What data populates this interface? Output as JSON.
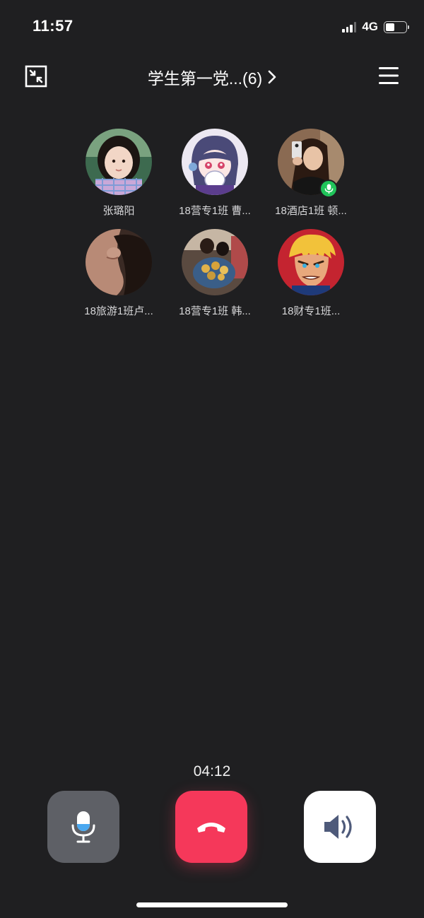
{
  "status_bar": {
    "time": "11:57",
    "network": "4G"
  },
  "nav": {
    "title": "学生第一党...(6)",
    "minimize_icon": "minimize-icon",
    "chevron_icon": "chevron-right-icon",
    "menu_icon": "menu-icon"
  },
  "participants": [
    {
      "name": "张璐阳",
      "avatar": "girl-photo"
    },
    {
      "name": "18营专1班 曹...",
      "avatar": "anime-girl"
    },
    {
      "name": "18酒店1班 顿...",
      "avatar": "selfie-photo",
      "speaking": true
    },
    {
      "name": "18旅游1班卢...",
      "avatar": "profile-photo"
    },
    {
      "name": "18营专1班 韩...",
      "avatar": "bouquet-photo"
    },
    {
      "name": "18财专1班...",
      "avatar": "cartoon-hero"
    }
  ],
  "call": {
    "duration": "04:12",
    "mute_icon": "microphone-icon",
    "hangup_icon": "hang-up-icon",
    "speaker_icon": "speaker-icon"
  },
  "colors": {
    "background": "#1f1f21",
    "hangup": "#f5385a",
    "mute_button": "#5e6066",
    "speaker_button": "#ffffff",
    "speaking_badge": "#20c45a"
  }
}
